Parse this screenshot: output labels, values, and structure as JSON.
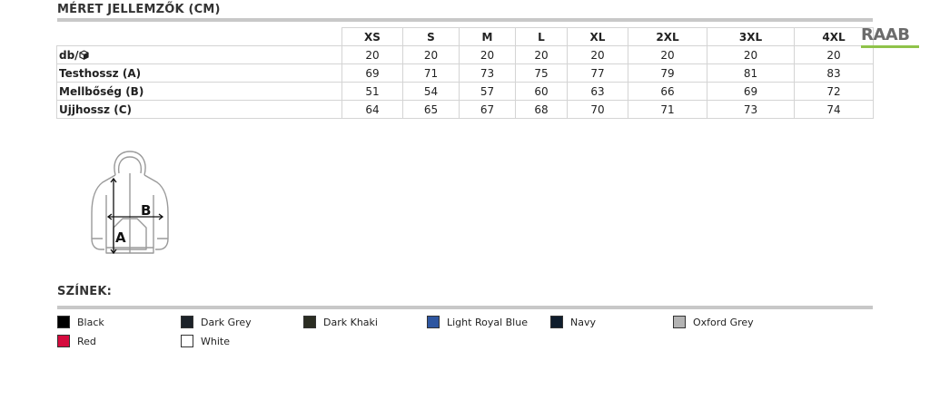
{
  "header": {
    "title": "MÉRET JELLEMZŐK (CM)"
  },
  "logo": {
    "text": "RAAB"
  },
  "size_table": {
    "columns": [
      "XS",
      "S",
      "M",
      "L",
      "XL",
      "2XL",
      "3XL",
      "4XL"
    ],
    "rows": [
      {
        "label": "db/",
        "icon": "box-icon",
        "values": [
          "20",
          "20",
          "20",
          "20",
          "20",
          "20",
          "20",
          "20"
        ]
      },
      {
        "label": "Testhossz (A)",
        "values": [
          "69",
          "71",
          "73",
          "75",
          "77",
          "79",
          "81",
          "83"
        ]
      },
      {
        "label": "Mellbőség (B)",
        "values": [
          "51",
          "54",
          "57",
          "60",
          "63",
          "66",
          "69",
          "72"
        ]
      },
      {
        "label": "Ujjhossz (C)",
        "values": [
          "64",
          "65",
          "67",
          "68",
          "70",
          "71",
          "73",
          "74"
        ]
      }
    ]
  },
  "diagram": {
    "label_a": "A",
    "label_b": "B"
  },
  "colors_section": {
    "title": "SZÍNEK:",
    "items": [
      {
        "name": "Black",
        "hex": "#000000"
      },
      {
        "name": "Dark Grey",
        "hex": "#1c2229"
      },
      {
        "name": "Dark Khaki",
        "hex": "#2b2d22"
      },
      {
        "name": "Light Royal Blue",
        "hex": "#2e56a0"
      },
      {
        "name": "Navy",
        "hex": "#0f1d2c"
      },
      {
        "name": "Oxford Grey",
        "hex": "#b3b3b3"
      },
      {
        "name": "Red",
        "hex": "#d50b3e"
      },
      {
        "name": "White",
        "hex": "#ffffff"
      }
    ]
  }
}
